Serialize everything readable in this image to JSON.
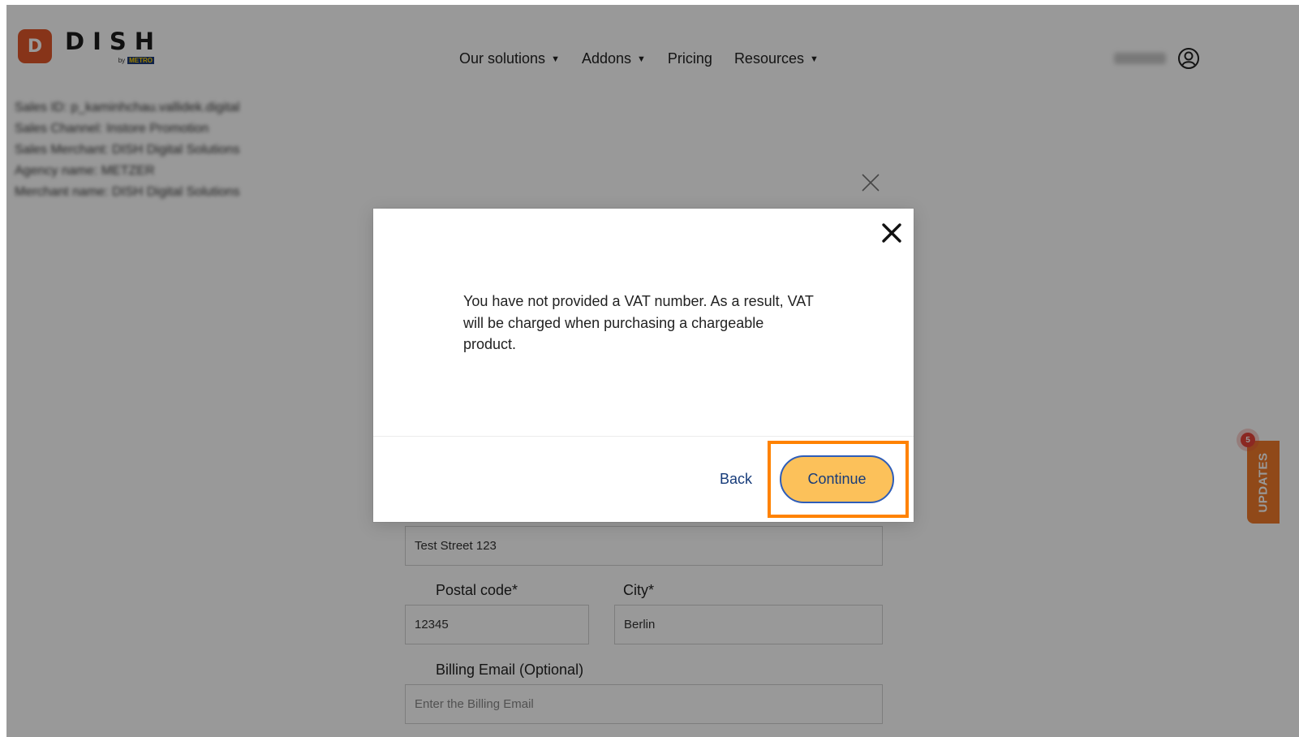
{
  "brand": {
    "logo_letter": "D",
    "name": "DISH",
    "by": "by",
    "partner": "METRO"
  },
  "nav": {
    "items": [
      {
        "label": "Our solutions",
        "has_dropdown": true
      },
      {
        "label": "Addons",
        "has_dropdown": true
      },
      {
        "label": "Pricing",
        "has_dropdown": false
      },
      {
        "label": "Resources",
        "has_dropdown": true
      }
    ],
    "caret": "▼"
  },
  "info_lines": [
    "Sales ID: p_kaminhchau.vallidek.digital",
    "Sales Channel: Instore Promotion",
    "Sales Merchant: DISH Digital Solutions",
    "Agency name: METZER",
    "Merchant name: DISH Digital Solutions"
  ],
  "form": {
    "street_value": "Test Street 123",
    "postal_label": "Postal code*",
    "postal_value": "12345",
    "city_label": "City*",
    "city_value": "Berlin",
    "billing_label": "Billing Email (Optional)",
    "billing_placeholder": "Enter the Billing Email"
  },
  "updates": {
    "label": "UPDATES",
    "count": "5"
  },
  "modal": {
    "message": "You have not provided a VAT number. As a result, VAT will be charged when purchasing a chargeable product.",
    "back_label": "Back",
    "continue_label": "Continue"
  },
  "colors": {
    "brand_orange": "#e2572b",
    "button_yellow": "#fcc15a",
    "button_text": "#173c7a",
    "highlight": "#ff8200",
    "updates_tab": "#f07b2b"
  }
}
